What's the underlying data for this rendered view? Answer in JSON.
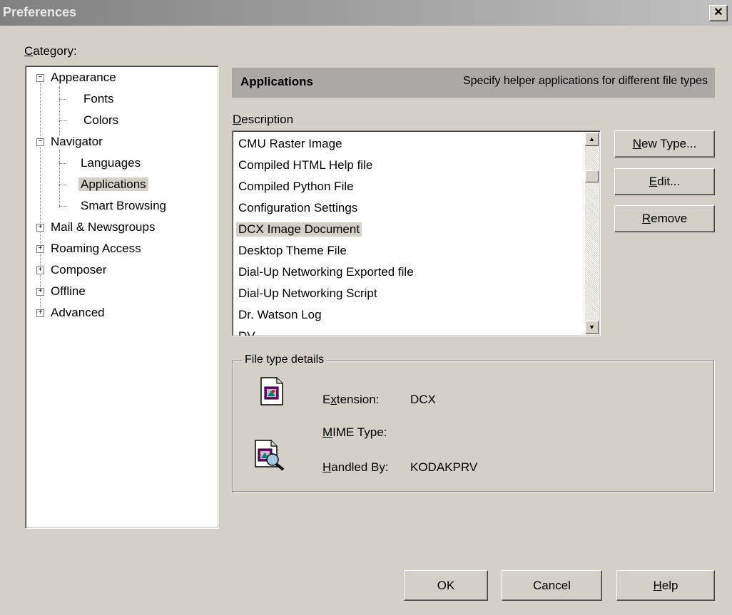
{
  "window": {
    "title": "Preferences",
    "close_label": "✕"
  },
  "category": {
    "label_prefix": "",
    "label_u": "C",
    "label_rest": "ategory:"
  },
  "tree": {
    "appearance": "Appearance",
    "fonts": "Fonts",
    "colors": "Colors",
    "navigator": "Navigator",
    "languages": "Languages",
    "applications": "Applications",
    "smart_browsing": "Smart Browsing",
    "mail": "Mail & Newsgroups",
    "roaming": "Roaming Access",
    "composer": "Composer",
    "offline": "Offline",
    "advanced": "Advanced",
    "minus": "−",
    "plus": "+"
  },
  "header": {
    "title": "Applications",
    "description": "Specify helper applications for different file types"
  },
  "description_label": {
    "u": "D",
    "rest": "escription"
  },
  "file_types": [
    "CMU Raster Image",
    "Compiled HTML Help file",
    "Compiled Python File",
    "Configuration Settings",
    "DCX Image Document",
    "Desktop Theme File",
    "Dial-Up Networking Exported file",
    "Dial-Up Networking Script",
    "Dr. Watson Log",
    "DV"
  ],
  "selected_file_type": "DCX Image Document",
  "scroll": {
    "up_arrow": "▲",
    "down_arrow": "▼"
  },
  "buttons": {
    "new_type_u": "N",
    "new_type_rest": "ew Type...",
    "edit_u": "E",
    "edit_rest": "dit...",
    "remove_u": "R",
    "remove_rest": "emove",
    "ok": "OK",
    "cancel": "Cancel",
    "help_u": "H",
    "help_rest": "elp"
  },
  "details": {
    "legend": "File type details",
    "extension_pre": "E",
    "extension_u": "x",
    "extension_rest": "tension:",
    "extension_value": "DCX",
    "mime_u": "M",
    "mime_rest": "IME Type:",
    "mime_value": "",
    "handled_u": "H",
    "handled_rest": "andled By:",
    "handled_value": "KODAKPRV"
  }
}
